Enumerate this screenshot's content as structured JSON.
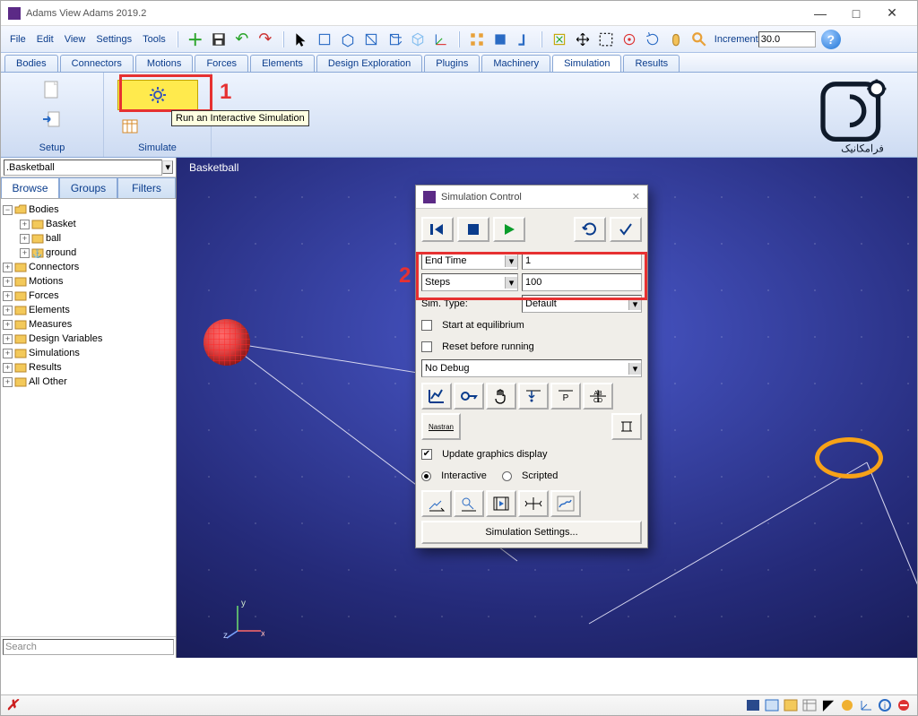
{
  "window": {
    "title": "Adams View Adams 2019.2",
    "min": "—",
    "max": "□",
    "close": "✕"
  },
  "menu": [
    "File",
    "Edit",
    "View",
    "Settings",
    "Tools"
  ],
  "toolbar": {
    "increment_label": "Increment",
    "increment_value": "30.0"
  },
  "tabs": [
    "Bodies",
    "Connectors",
    "Motions",
    "Forces",
    "Elements",
    "Design Exploration",
    "Plugins",
    "Machinery",
    "Simulation",
    "Results"
  ],
  "active_tab": "Simulation",
  "ribbon": {
    "setup": "Setup",
    "simulate": "Simulate",
    "tooltip": "Run an Interactive Simulation"
  },
  "annotations": {
    "one": "1",
    "two": "2"
  },
  "sidebar": {
    "model": ".Basketball",
    "tabs": [
      "Browse",
      "Groups",
      "Filters"
    ],
    "browse": {
      "bodies": "Bodies",
      "basket": "Basket",
      "ball": "ball",
      "ground": "ground",
      "connectors": "Connectors",
      "motions": "Motions",
      "forces": "Forces",
      "elements": "Elements",
      "measures": "Measures",
      "dvars": "Design Variables",
      "sims": "Simulations",
      "results": "Results",
      "other": "All Other"
    },
    "search_placeholder": "Search"
  },
  "viewport": {
    "label": "Basketball",
    "triad": {
      "x": "x",
      "y": "y",
      "z": "z"
    }
  },
  "dialog": {
    "title": "Simulation Control",
    "end_time_label": "End Time",
    "end_time_value": "1",
    "steps_label": "Steps",
    "steps_value": "100",
    "sim_type_label": "Sim. Type:",
    "sim_type_value": "Default",
    "start_equil": "Start at equilibrium",
    "reset_before": "Reset before running",
    "debug": "No Debug",
    "nastran": "Nastran",
    "update": "Update graphics display",
    "interactive": "Interactive",
    "scripted": "Scripted",
    "settings": "Simulation Settings...",
    "close": "✕"
  },
  "watermark": "فرامکانیک"
}
